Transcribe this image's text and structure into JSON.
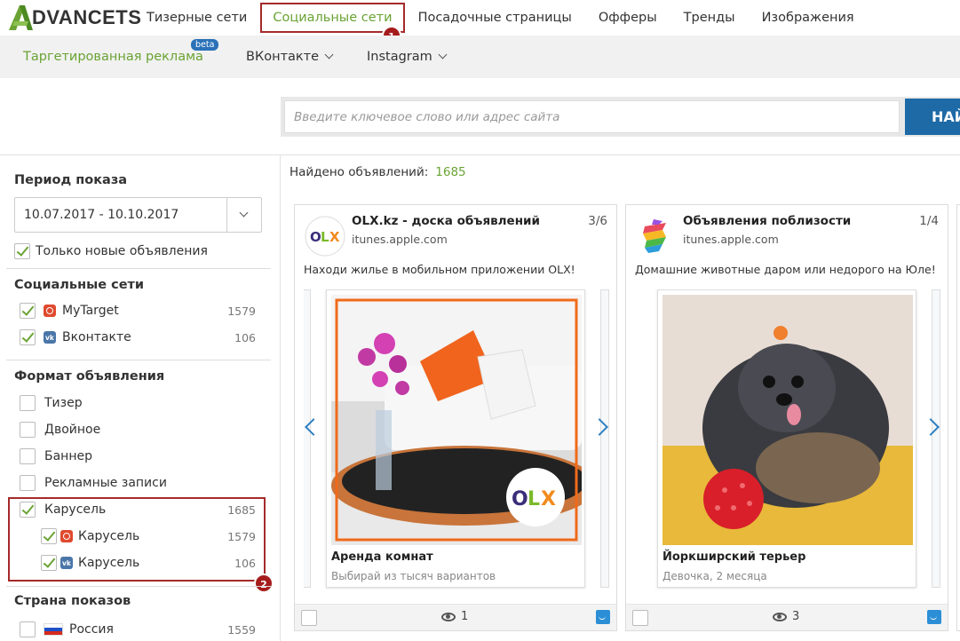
{
  "brand": {
    "logo_text": "DVANCETS",
    "accent": "#6aa334",
    "brand_blue": "#1e6aa6",
    "marker_red": "#a51c1c"
  },
  "nav": {
    "items": [
      "Тизерные сети",
      "Социальные сети",
      "Посадочные страницы",
      "Офферы",
      "Тренды",
      "Изображения"
    ],
    "active": "Социальные сети",
    "marker": "1"
  },
  "subnav": {
    "targeted": "Таргетированная реклама",
    "beta": "beta",
    "vk": "ВКонтакте",
    "instagram": "Instagram"
  },
  "search": {
    "placeholder": "Введите ключевое слово или адрес сайта",
    "button": "НАЙ"
  },
  "sidebar": {
    "period": {
      "title": "Период показа",
      "range": "10.07.2017 - 10.10.2017",
      "only_new": "Только новые объявления",
      "only_new_checked": true
    },
    "networks": {
      "title": "Социальные сети",
      "items": [
        {
          "label": "MyTarget",
          "count": "1579",
          "icon": "mytarget-icon",
          "checked": true
        },
        {
          "label": "Вконтакте",
          "count": "106",
          "icon": "vk-icon",
          "checked": true
        }
      ]
    },
    "format": {
      "title": "Формат объявления",
      "items": [
        {
          "label": "Тизер",
          "checked": false
        },
        {
          "label": "Двойное",
          "checked": false
        },
        {
          "label": "Баннер",
          "checked": false
        },
        {
          "label": "Рекламные записи",
          "checked": false
        },
        {
          "label": "Карусель",
          "count": "1685",
          "checked": true
        },
        {
          "label": "Карусель",
          "count": "1579",
          "icon": "mytarget-icon",
          "checked": true
        },
        {
          "label": "Карусель",
          "count": "106",
          "icon": "vk-icon",
          "checked": true
        }
      ],
      "marker": "2"
    },
    "country": {
      "title": "Страна показов",
      "items": [
        {
          "label": "Россия",
          "count": "1559",
          "icon": "russia-flag-icon",
          "checked": false
        }
      ]
    }
  },
  "results": {
    "label": "Найдено объявлений:",
    "count": "1685"
  },
  "cards": [
    {
      "title": "OLX.kz - доска объявлений",
      "domain": "itunes.apple.com",
      "pager": "3/6",
      "text": "Находи жилье в мобильном приложении OLX!",
      "slide_title": "Аренда комнат",
      "slide_sub": "Выбирай из тысяч вариантов",
      "views": "1",
      "logo_text": "OLX"
    },
    {
      "title": "Объявления поблизости",
      "domain": "itunes.apple.com",
      "pager": "1/4",
      "text": "Домашние животные даром или недорого на Юле!",
      "slide_title": "Йоркширский терьер",
      "slide_sub": "Девочка, 2 месяца",
      "views": "3"
    }
  ]
}
